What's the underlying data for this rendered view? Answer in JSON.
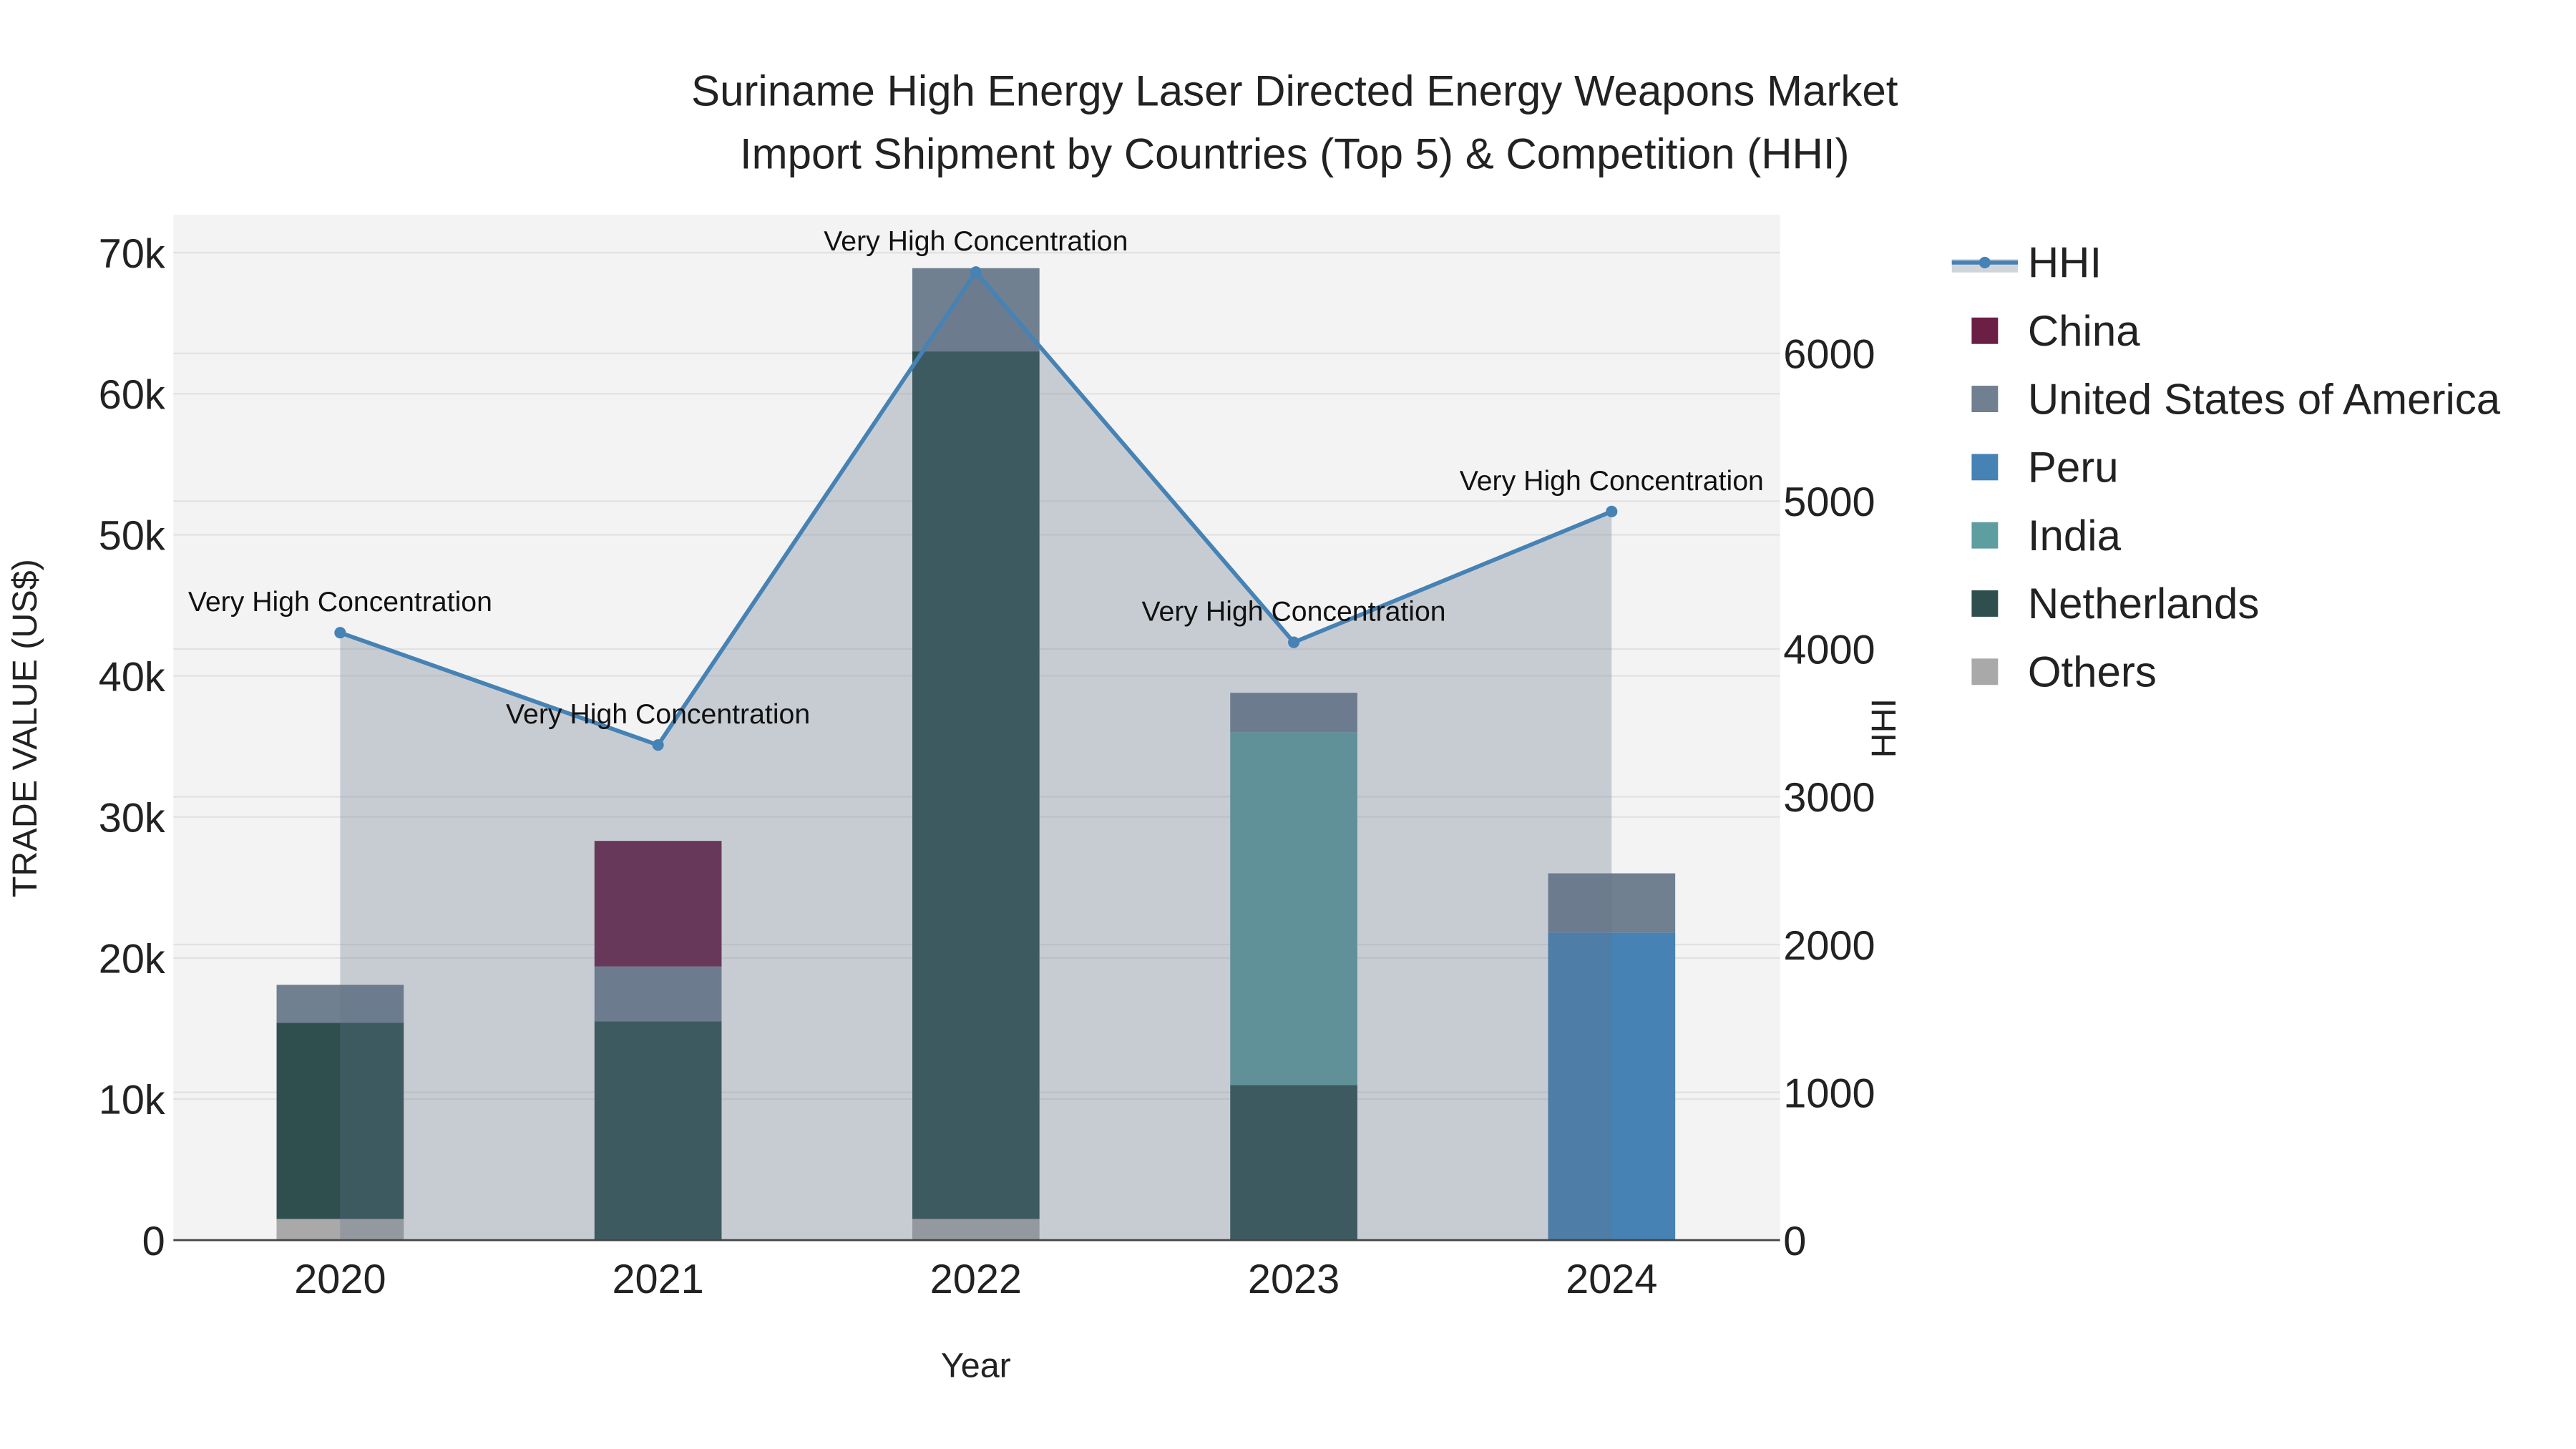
{
  "chart_data": {
    "type": "bar",
    "stacked": true,
    "title_lines": [
      "Suriname High Energy Laser Directed Energy Weapons Market",
      "Import Shipment by Countries (Top 5) & Competition (HHI)"
    ],
    "xlabel": "Year",
    "ylabel": "TRADE VALUE (US$)",
    "y2label": "HHI",
    "categories": [
      "2020",
      "2021",
      "2022",
      "2023",
      "2024"
    ],
    "ylim": [
      0,
      70000
    ],
    "y_ticks": [
      0,
      10000,
      20000,
      30000,
      40000,
      50000,
      60000,
      70000
    ],
    "y_tick_labels": [
      "0",
      "10k",
      "20k",
      "30k",
      "40k",
      "50k",
      "60k",
      "70k"
    ],
    "y2lim": [
      0,
      6900
    ],
    "y2_ticks": [
      0,
      1000,
      2000,
      3000,
      4000,
      5000,
      6000
    ],
    "y2_tick_labels": [
      "0",
      "1000",
      "2000",
      "3000",
      "4000",
      "5000",
      "6000"
    ],
    "series": [
      {
        "name": "Others",
        "color": "#a9a9a9",
        "values": [
          1500,
          0,
          1500,
          0,
          0
        ]
      },
      {
        "name": "Netherlands",
        "color": "#2f4f4f",
        "values": [
          13900,
          15500,
          61500,
          11000,
          0
        ]
      },
      {
        "name": "India",
        "color": "#5f9ea0",
        "values": [
          0,
          0,
          0,
          25000,
          0
        ]
      },
      {
        "name": "Peru",
        "color": "#4682b4",
        "values": [
          0,
          0,
          0,
          0,
          21800
        ]
      },
      {
        "name": "United States of America",
        "color": "#708090",
        "values": [
          2700,
          3900,
          5900,
          2800,
          4200
        ]
      },
      {
        "name": "China",
        "color": "#6b1f45",
        "values": [
          0,
          8900,
          0,
          0,
          0
        ]
      }
    ],
    "hhi": {
      "name": "HHI",
      "color": "#4682b4",
      "values": [
        4110,
        3350,
        6550,
        4045,
        4930
      ],
      "annotations": [
        "Very High Concentration",
        "Very High Concentration",
        "Very High Concentration",
        "Very High Concentration",
        "Very High Concentration"
      ]
    },
    "legend": [
      "HHI",
      "China",
      "United States of America",
      "Peru",
      "India",
      "Netherlands",
      "Others"
    ],
    "legend_placement": "right",
    "grid": true
  }
}
